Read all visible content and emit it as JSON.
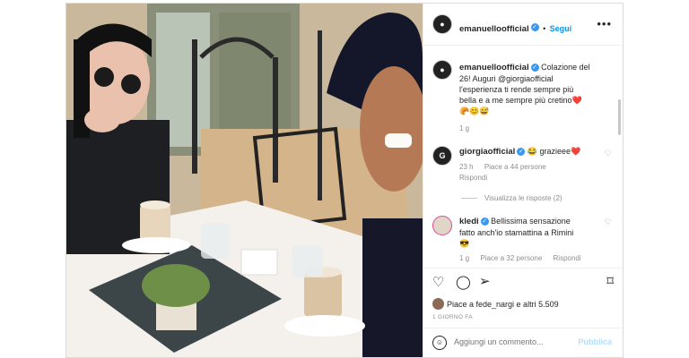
{
  "header": {
    "username": "emanuelloofficial",
    "follow_label": "Segui",
    "more_label": "•••"
  },
  "caption": {
    "username": "emanuelloofficial",
    "text_lines": [
      "Colazione del",
      "26! Auguri @giorgiaofficial",
      "l'esperienza ti rende sempre più",
      "bella e a me sempre più cretino❤️"
    ],
    "emoji_line": "🥐😊😅",
    "time": "1 g"
  },
  "comments": [
    {
      "username": "giorgiaofficial",
      "avatar_text": "G",
      "text": "😂 grazieee❤️",
      "time": "23 h",
      "likes": "Piace a 44 persone",
      "reply": "Rispondi",
      "view_replies": "Visualizza le risposte (2)"
    },
    {
      "username": "kledi",
      "avatar_text": "",
      "text_lines": [
        "Bellissima sensazione",
        "fatto anch'io stamattina a Rimini",
        "😎"
      ],
      "time": "1 g",
      "likes": "Piace a 32 persone",
      "reply": "Rispondi"
    }
  ],
  "actions": {
    "likes_text": "Piace a fede_nargi e altri 5.509",
    "date": "1 GIORNO FA"
  },
  "add_comment": {
    "placeholder": "Aggiungi un commento...",
    "publish_label": "Pubblica"
  },
  "colors": {
    "link": "#0095f6",
    "verified": "#3897f0",
    "heart": "#ed4956"
  }
}
